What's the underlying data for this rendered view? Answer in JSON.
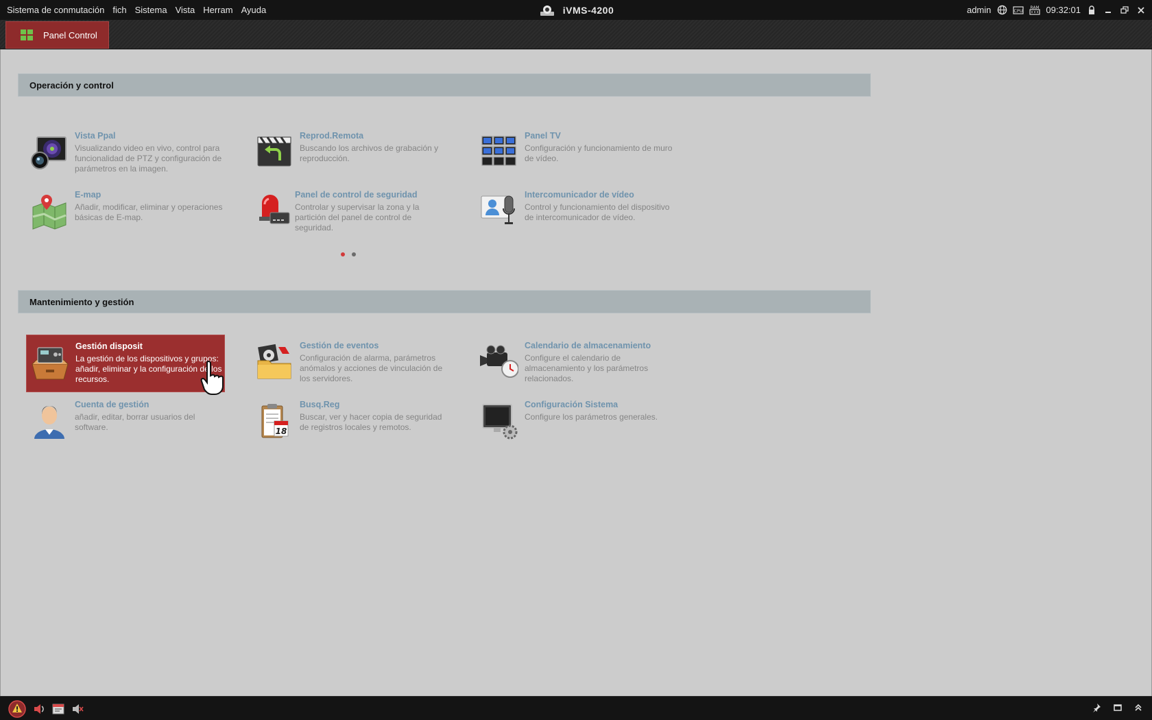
{
  "menu": [
    "Sistema de conmutación",
    "fich",
    "Sistema",
    "Vista",
    "Herram",
    "Ayuda"
  ],
  "app_title": "iVMS-4200",
  "tray": {
    "user": "admin",
    "cpu": "CPU",
    "ram": "RAM",
    "time": "09:32:01"
  },
  "tab": {
    "label": "Panel Control"
  },
  "sections": {
    "operation": "Operación y control",
    "maintenance": "Mantenimiento y gestión"
  },
  "operation": [
    {
      "title": "Vista Ppal",
      "desc": "Visualizando video en vivo, control para funcionalidad de PTZ y configuración de parámetros en la imagen."
    },
    {
      "title": "Reprod.Remota",
      "desc": "Buscando los archivos de grabación y reproducción."
    },
    {
      "title": "Panel TV",
      "desc": "Configuración y funcionamiento de muro de vídeo."
    },
    {
      "title": "E-map",
      "desc": "Añadir, modificar, eliminar y operaciones básicas de E-map."
    },
    {
      "title": "Panel de control de seguridad",
      "desc": "Controlar y supervisar la zona y la partición del panel de control de seguridad."
    },
    {
      "title": "Intercomunicador de vídeo",
      "desc": "Control y funcionamiento del dispositivo de intercomunicador de vídeo."
    }
  ],
  "maintenance": [
    {
      "title": "Gestión disposit",
      "desc": "La gestión de los dispositivos y grupos: añadir, eliminar y la configuración de los recursos."
    },
    {
      "title": "Gestión de eventos",
      "desc": "Configuración de alarma, parámetros anómalos y acciones de vinculación de los servidores."
    },
    {
      "title": "Calendario de almacenamiento",
      "desc": "Configure el calendario de almacenamiento y los parámetros relacionados."
    },
    {
      "title": "Cuenta de gestión",
      "desc": "añadir, editar, borrar usuarios del software."
    },
    {
      "title": "Busq.Reg",
      "desc": "Buscar, ver y hacer copia de seguridad de registros locales y remotos."
    },
    {
      "title": "Configuración Sistema",
      "desc": "Configure los parámetros generales."
    }
  ],
  "calendar_day": "18",
  "pagination": {
    "current": 1,
    "total": 2
  },
  "colors": {
    "accent": "#9b2f2f",
    "title_link": "#6f93ad",
    "header_band": "#a9b2b5"
  }
}
